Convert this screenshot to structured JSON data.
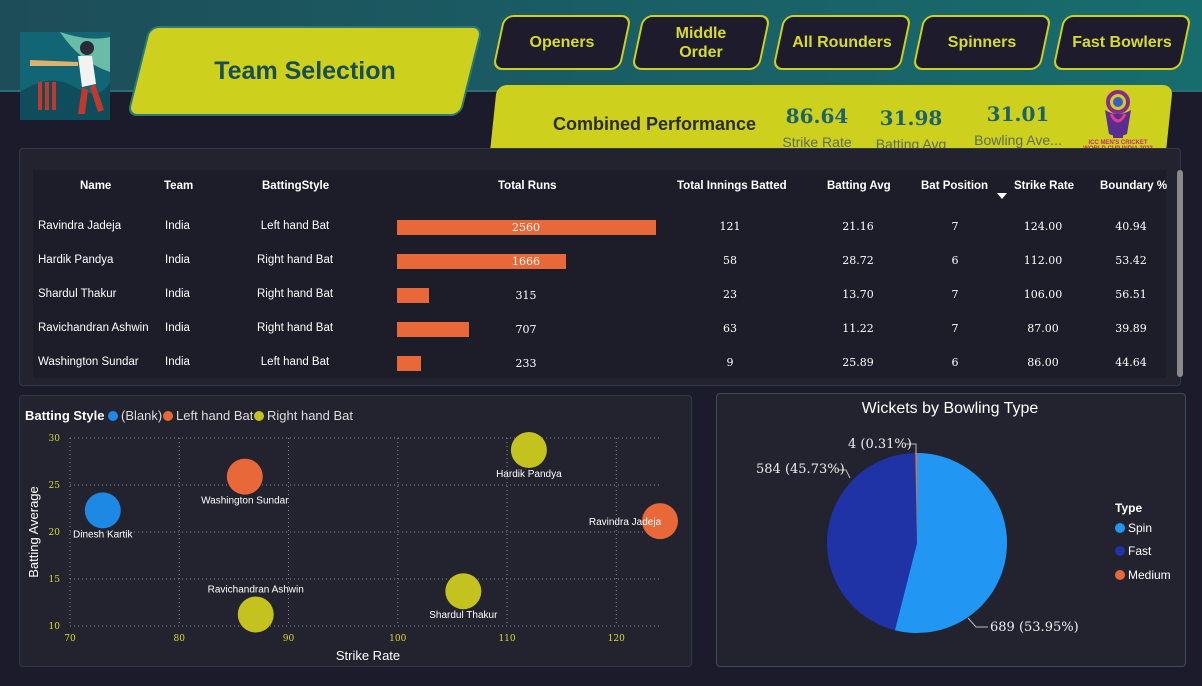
{
  "header": {
    "title": "Team Selection",
    "nav": [
      {
        "label": "Openers"
      },
      {
        "label": "Middle Order"
      },
      {
        "label": "All Rounders"
      },
      {
        "label": "Spinners"
      },
      {
        "label": "Fast Bowlers"
      }
    ],
    "logo_icon": "cricket-batsman-logo",
    "worldcup_logo_text": "ICC MEN'S CRICKET WORLD CUP INDIA 2023"
  },
  "performance": {
    "title": "Combined Performance",
    "kpis": [
      {
        "value": "86.64",
        "label": "Strike Rate"
      },
      {
        "value": "31.98",
        "label": "Batting Avg"
      },
      {
        "value": "31.01",
        "label": "Bowling Ave..."
      }
    ]
  },
  "table": {
    "columns": [
      "Name",
      "Team",
      "BattingStyle",
      "Total Runs",
      "Total Innings Batted",
      "Batting Avg",
      "Bat Position",
      "Strike Rate",
      "Boundary %"
    ],
    "sorted_column": "Strike Rate",
    "max_runs": 2560,
    "rows": [
      {
        "name": "Ravindra Jadeja",
        "team": "India",
        "style": "Left hand Bat",
        "runs": 2560,
        "runs_label": "2560",
        "innings": "121",
        "avg": "21.16",
        "pos": "7",
        "sr": "124.00",
        "boundary": "40.94"
      },
      {
        "name": "Hardik Pandya",
        "team": "India",
        "style": "Right hand Bat",
        "runs": 1666,
        "runs_label": "1666",
        "innings": "58",
        "avg": "28.72",
        "pos": "6",
        "sr": "112.00",
        "boundary": "53.42"
      },
      {
        "name": "Shardul Thakur",
        "team": "India",
        "style": "Right hand Bat",
        "runs": 315,
        "runs_label": "315",
        "innings": "23",
        "avg": "13.70",
        "pos": "7",
        "sr": "106.00",
        "boundary": "56.51"
      },
      {
        "name": "Ravichandran Ashwin",
        "team": "India",
        "style": "Right hand Bat",
        "runs": 707,
        "runs_label": "707",
        "innings": "63",
        "avg": "11.22",
        "pos": "7",
        "sr": "87.00",
        "boundary": "39.89"
      },
      {
        "name": "Washington Sundar",
        "team": "India",
        "style": "Left hand Bat",
        "runs": 233,
        "runs_label": "233",
        "innings": "9",
        "avg": "25.89",
        "pos": "6",
        "sr": "86.00",
        "boundary": "44.64"
      }
    ]
  },
  "scatter": {
    "legend_title": "Batting Style",
    "legend": [
      {
        "label": "(Blank)",
        "color": "#1e88e5"
      },
      {
        "label": "Left hand Bat",
        "color": "#e8683a"
      },
      {
        "label": "Right hand Bat",
        "color": "#c4c21e"
      }
    ]
  },
  "pie": {
    "title": "Wickets by Bowling Type",
    "legend_title": "Type",
    "labels": [
      "689 (53.95%)",
      "584 (45.73%)",
      "4 (0.31%)"
    ]
  },
  "chart_data": [
    {
      "type": "scatter",
      "title": "",
      "xlabel": "Strike Rate",
      "ylabel": "Batting Average",
      "xlim": [
        70,
        124
      ],
      "ylim": [
        10,
        30
      ],
      "xticks": [
        "70",
        "80",
        "90",
        "100",
        "110",
        "120"
      ],
      "yticks": [
        "10",
        "15",
        "20",
        "25",
        "30"
      ],
      "grid": true,
      "points": [
        {
          "label": "Dinesh Kartik",
          "x": 73,
          "y": 22.3,
          "series": "(Blank)"
        },
        {
          "label": "Washington Sundar",
          "x": 86,
          "y": 25.89,
          "series": "Left hand Bat"
        },
        {
          "label": "Hardik Pandya",
          "x": 112,
          "y": 28.72,
          "series": "Right hand Bat"
        },
        {
          "label": "Ravindra Jadeja",
          "x": 124,
          "y": 21.16,
          "series": "Left hand Bat"
        },
        {
          "label": "Ravichandran Ashwin",
          "x": 87,
          "y": 11.22,
          "series": "Right hand Bat"
        },
        {
          "label": "Shardul Thakur",
          "x": 106,
          "y": 13.7,
          "series": "Right hand Bat"
        }
      ]
    },
    {
      "type": "pie",
      "title": "Wickets by Bowling Type",
      "slices": [
        {
          "label": "Spin",
          "value": 689,
          "percent": 53.95,
          "color": "#2196f3"
        },
        {
          "label": "Fast",
          "value": 584,
          "percent": 45.73,
          "color": "#1f33a6"
        },
        {
          "label": "Medium",
          "value": 4,
          "percent": 0.31,
          "color": "#e8683a"
        }
      ]
    }
  ]
}
